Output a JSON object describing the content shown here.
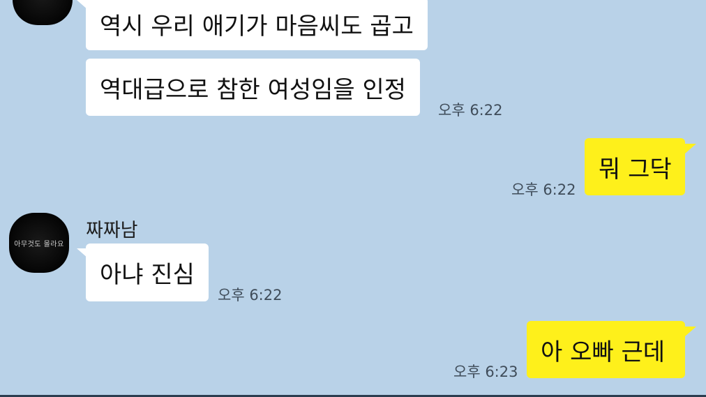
{
  "colors": {
    "background": "#b9d2e8",
    "incoming_bubble": "#ffffff",
    "outgoing_bubble": "#fef01b",
    "time_text": "#3f4c59"
  },
  "messages": [
    {
      "direction": "incoming",
      "text": "역시 우리 애기가 마음씨도 곱고"
    },
    {
      "direction": "incoming",
      "text": "역대급으로 참한 여성임을 인정",
      "time": "오후 6:22"
    },
    {
      "direction": "outgoing",
      "text": "뭐 그닥",
      "time": "오후 6:22"
    },
    {
      "direction": "incoming",
      "sender": "짜짜남",
      "avatar_text": "아무것도 몰라요",
      "text": "아냐 진심",
      "time": "오후 6:22"
    },
    {
      "direction": "outgoing",
      "text": "아 오빠 근데",
      "time": "오후 6:23"
    }
  ]
}
